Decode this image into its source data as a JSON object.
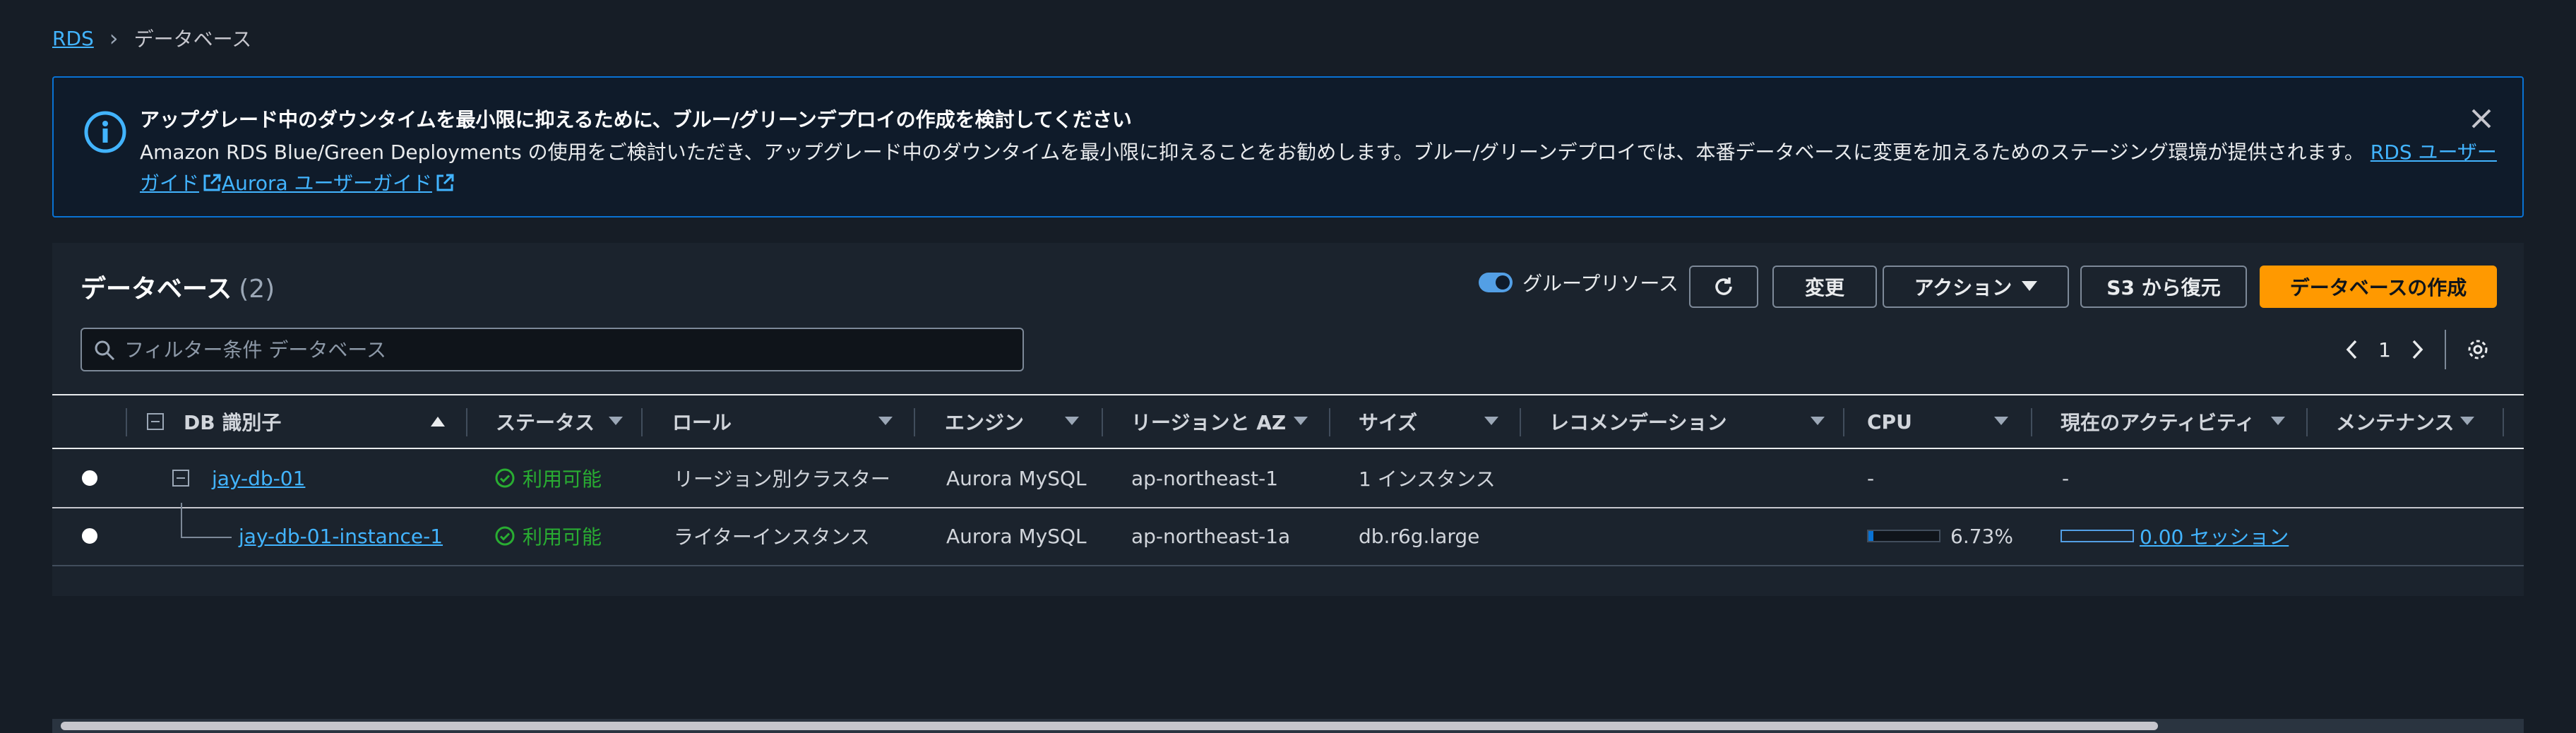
{
  "breadcrumb": {
    "root": "RDS",
    "current": "データベース"
  },
  "banner": {
    "title": "アップグレード中のダウンタイムを最小限に抑えるために、ブルー/グリーンデプロイの作成を検討してください",
    "body": "Amazon RDS Blue/Green Deployments の使用をご検討いただき、アップグレード中のダウンタイムを最小限に抑えることをお勧めします。ブルー/グリーンデプロイでは、本番データベースに変更を加えるためのステージング環境が提供されます。",
    "link1": "RDS ユーザーガイド",
    "link2": "Aurora ユーザーガイド",
    "accent": "#0972d3"
  },
  "panel": {
    "title": "データベース",
    "count": "(2)",
    "group_toggle": "グループリソース",
    "buttons": {
      "modify": "変更",
      "actions": "アクション",
      "restore": "S3 から復元",
      "create": "データベースの作成"
    },
    "filter_placeholder": "フィルター条件 データベース",
    "page": "1"
  },
  "table": {
    "headers": {
      "db_id": "DB 識別子",
      "status": "ステータス",
      "role": "ロール",
      "engine": "エンジン",
      "region": "リージョンと AZ",
      "size": "サイズ",
      "recommend": "レコメンデーション",
      "cpu": "CPU",
      "activity": "現在のアクティビティ",
      "maintenance": "メンテナンス"
    },
    "rows": [
      {
        "db_id": "jay-db-01",
        "status": "利用可能",
        "role": "リージョン別クラスター",
        "engine": "Aurora MySQL",
        "region": "ap-northeast-1",
        "size": "1 インスタンス",
        "recommend": "",
        "cpu": "-",
        "activity": "-"
      },
      {
        "db_id": "jay-db-01-instance-1",
        "status": "利用可能",
        "role": "ライターインスタンス",
        "engine": "Aurora MySQL",
        "region": "ap-northeast-1a",
        "size": "db.r6g.large",
        "recommend": "",
        "cpu": "6.73%",
        "cpu_fraction": 0.0673,
        "activity": "0.00 セッション"
      }
    ]
  },
  "colors": {
    "status_ok": "#29ad32",
    "link": "#42b4ff",
    "primary": "#ff9900"
  }
}
